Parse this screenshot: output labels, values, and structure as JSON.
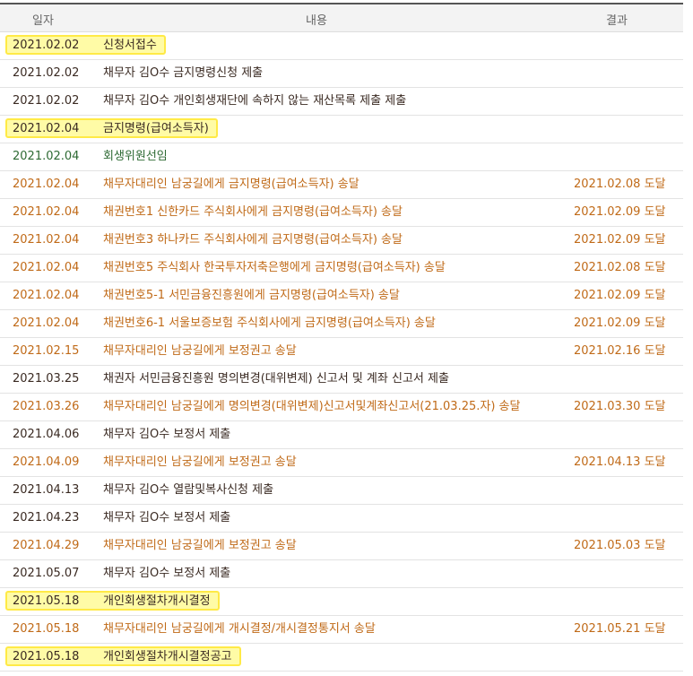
{
  "columns": {
    "date": "일자",
    "content": "내용",
    "result": "결과"
  },
  "rows": [
    {
      "date": "2021.02.02",
      "content": "신청서접수",
      "result": "",
      "tone": "normal",
      "highlight": true
    },
    {
      "date": "2021.02.02",
      "content": "채무자 김O수 금지명령신청 제출",
      "result": "",
      "tone": "normal",
      "highlight": false
    },
    {
      "date": "2021.02.02",
      "content": "채무자 김O수 개인회생재단에 속하지 않는 재산목록 제출 제출",
      "result": "",
      "tone": "normal",
      "highlight": false
    },
    {
      "date": "2021.02.04",
      "content": "금지명령(급여소득자)",
      "result": "",
      "tone": "normal",
      "highlight": true
    },
    {
      "date": "2021.02.04",
      "content": "회생위원선임",
      "result": "",
      "tone": "green",
      "highlight": false
    },
    {
      "date": "2021.02.04",
      "content": "채무자대리인 남궁길에게 금지명령(급여소득자) 송달",
      "result": "2021.02.08 도달",
      "tone": "orange",
      "highlight": false
    },
    {
      "date": "2021.02.04",
      "content": "채권번호1 신한카드 주식회사에게 금지명령(급여소득자) 송달",
      "result": "2021.02.09 도달",
      "tone": "orange",
      "highlight": false
    },
    {
      "date": "2021.02.04",
      "content": "채권번호3 하나카드 주식회사에게 금지명령(급여소득자) 송달",
      "result": "2021.02.09 도달",
      "tone": "orange",
      "highlight": false
    },
    {
      "date": "2021.02.04",
      "content": "채권번호5 주식회사 한국투자저축은행에게 금지명령(급여소득자) 송달",
      "result": "2021.02.08 도달",
      "tone": "orange",
      "highlight": false
    },
    {
      "date": "2021.02.04",
      "content": "채권번호5-1 서민금융진흥원에게 금지명령(급여소득자) 송달",
      "result": "2021.02.09 도달",
      "tone": "orange",
      "highlight": false
    },
    {
      "date": "2021.02.04",
      "content": "채권번호6-1 서울보증보험 주식회사에게 금지명령(급여소득자) 송달",
      "result": "2021.02.09 도달",
      "tone": "orange",
      "highlight": false
    },
    {
      "date": "2021.02.15",
      "content": "채무자대리인 남궁길에게 보정권고 송달",
      "result": "2021.02.16 도달",
      "tone": "orange",
      "highlight": false
    },
    {
      "date": "2021.03.25",
      "content": "채권자 서민금융진흥원 명의변경(대위변제) 신고서 및 계좌 신고서 제출",
      "result": "",
      "tone": "normal",
      "highlight": false
    },
    {
      "date": "2021.03.26",
      "content": "채무자대리인 남궁길에게 명의변경(대위변제)신고서및계좌신고서(21.03.25.자) 송달",
      "result": "2021.03.30 도달",
      "tone": "orange",
      "highlight": false
    },
    {
      "date": "2021.04.06",
      "content": "채무자 김O수 보정서 제출",
      "result": "",
      "tone": "normal",
      "highlight": false
    },
    {
      "date": "2021.04.09",
      "content": "채무자대리인 남궁길에게 보정권고 송달",
      "result": "2021.04.13 도달",
      "tone": "orange",
      "highlight": false
    },
    {
      "date": "2021.04.13",
      "content": "채무자 김O수 열람및복사신청 제출",
      "result": "",
      "tone": "normal",
      "highlight": false
    },
    {
      "date": "2021.04.23",
      "content": "채무자 김O수 보정서 제출",
      "result": "",
      "tone": "normal",
      "highlight": false
    },
    {
      "date": "2021.04.29",
      "content": "채무자대리인 남궁길에게 보정권고 송달",
      "result": "2021.05.03 도달",
      "tone": "orange",
      "highlight": false
    },
    {
      "date": "2021.05.07",
      "content": "채무자 김O수 보정서 제출",
      "result": "",
      "tone": "normal",
      "highlight": false
    },
    {
      "date": "2021.05.18",
      "content": "개인회생절차개시결정",
      "result": "",
      "tone": "normal",
      "highlight": true
    },
    {
      "date": "2021.05.18",
      "content": "채무자대리인 남궁길에게 개시결정/개시결정통지서 송달",
      "result": "2021.05.21 도달",
      "tone": "orange",
      "highlight": false
    },
    {
      "date": "2021.05.18",
      "content": "개인회생절차개시결정공고",
      "result": "",
      "tone": "normal",
      "highlight": true
    }
  ],
  "colors": {
    "normal_text": "#3a2a22",
    "orange_text": "#c06a18",
    "green_text": "#2e6a34",
    "highlight_fill": "#fffb9d",
    "highlight_border": "#ffe833"
  }
}
